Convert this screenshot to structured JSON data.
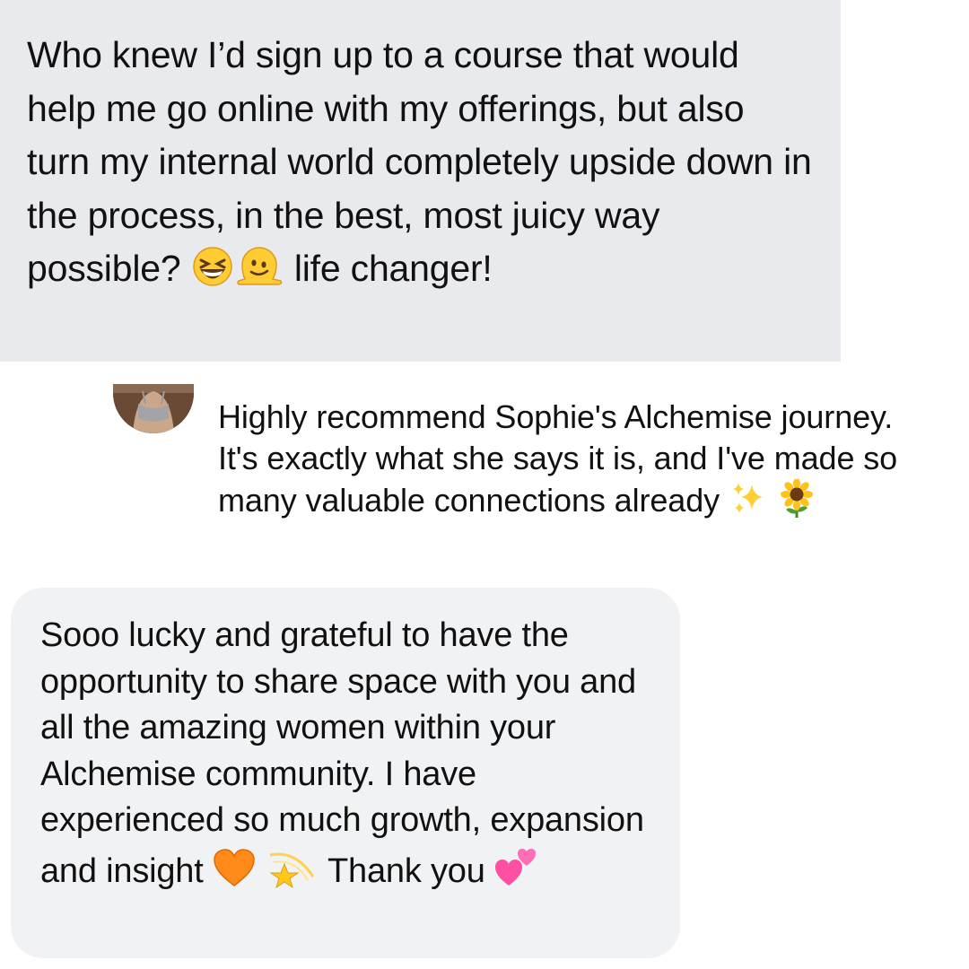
{
  "messages": {
    "first": {
      "text_1": "Who knew I’d sign up to a course that would help me go online with my offerings, but also turn my internal world completely upside down in the process, in the best, most juicy way possible?",
      "emojis_1": [
        "grinning-squinting-face-emoji",
        "melting-face-emoji"
      ],
      "text_2": "life changer!"
    },
    "second": {
      "avatar": "profile-photo",
      "text_1": "Highly recommend Sophie's Alchemise journey. It's exactly what she says it is, and I've made so many valuable connections already",
      "emojis_1": [
        "sparkles-emoji",
        "sunflower-emoji"
      ]
    },
    "third": {
      "text_1": "Sooo lucky and grateful to have the opportunity to share space with you and all the amazing women within your Alchemise community. I have experienced so much growth, expansion and insight",
      "emojis_1": [
        "orange-heart-emoji",
        "dizzy-emoji"
      ],
      "text_2": "Thank you",
      "emojis_2": [
        "two-hearts-emoji"
      ]
    }
  },
  "colors": {
    "first_bubble": "#e9eaee",
    "third_bubble": "#f1f2f4",
    "text": "#111111"
  }
}
